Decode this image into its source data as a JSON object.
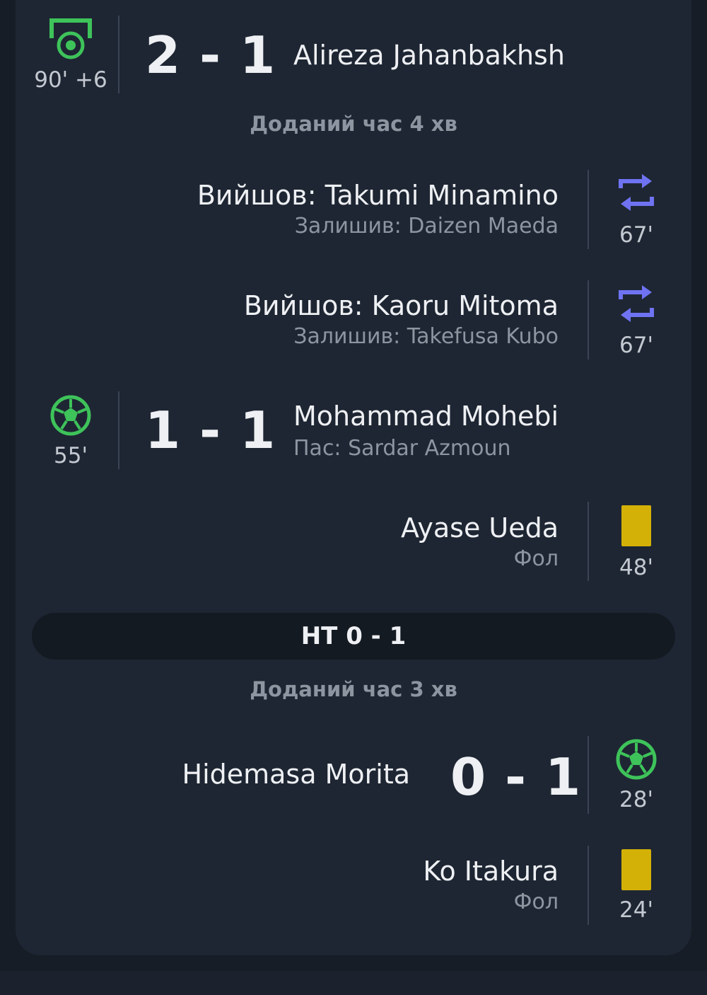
{
  "events": {
    "goal_90": {
      "time": "90' +6",
      "score": "2 - 1",
      "player": "Alireza Jahanbakhsh",
      "icon": "penalty-goal-icon"
    },
    "added_time_2": {
      "label": "Доданий час 4 хв"
    },
    "sub_minamino": {
      "in": "Вийшов: Takumi Minamino",
      "out": "Залишив: Daizen Maeda",
      "time": "67'",
      "icon": "substitution-icon"
    },
    "sub_mitoma": {
      "in": "Вийшов: Kaoru Mitoma",
      "out": "Залишив: Takefusa Kubo",
      "time": "67'",
      "icon": "substitution-icon"
    },
    "goal_55": {
      "time": "55'",
      "score": "1 - 1",
      "player": "Mohammad Mohebi",
      "assist": "Пас: Sardar Azmoun",
      "icon": "football-icon"
    },
    "card_ueda": {
      "player": "Ayase Ueda",
      "reason": "Фол",
      "time": "48'",
      "icon": "yellow-card-icon"
    },
    "halftime": {
      "label": "HT 0 - 1"
    },
    "added_time_1": {
      "label": "Доданий час 3 хв"
    },
    "goal_28": {
      "player": "Hidemasa Morita",
      "score": "0 - 1",
      "time": "28'",
      "icon": "football-icon"
    },
    "card_itakura": {
      "player": "Ko Itakura",
      "reason": "Фол",
      "time": "24'",
      "icon": "yellow-card-icon"
    }
  },
  "colors": {
    "goal_green": "#3ec35a",
    "sub_blue": "#6f73f2",
    "yellow_card": "#d4b107",
    "card_bg": "#1e2633",
    "page_bg": "#171d26"
  }
}
